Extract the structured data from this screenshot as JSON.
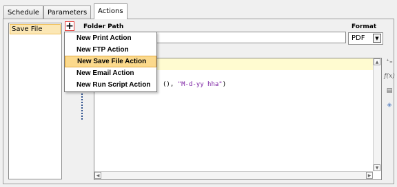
{
  "tabs": [
    {
      "label": "Schedule"
    },
    {
      "label": "Parameters"
    },
    {
      "label": "Actions"
    }
  ],
  "actions_list": [
    {
      "label": "Save File"
    }
  ],
  "add_button": {
    "label": "+"
  },
  "folder_path": {
    "label": "Folder Path",
    "value": ""
  },
  "format": {
    "label": "Format",
    "value": "PDF"
  },
  "editor": {
    "code_tail": "(), ",
    "code_string": "\"M-d-yy hha\"",
    "code_close": ")"
  },
  "menu": {
    "items": [
      {
        "label": "New Print Action"
      },
      {
        "label": "New FTP Action"
      },
      {
        "label": "New Save File Action"
      },
      {
        "label": "New Email Action"
      },
      {
        "label": "New Run Script Action"
      }
    ]
  },
  "icons": [
    "add-line-icon",
    "function-icon",
    "document-icon",
    "tag-icon"
  ],
  "colors": {
    "selection": "#fbe7b5",
    "menu_highlight": "#fbd98c",
    "string": "#7b1fa2",
    "highlight_border": "#e53935"
  }
}
